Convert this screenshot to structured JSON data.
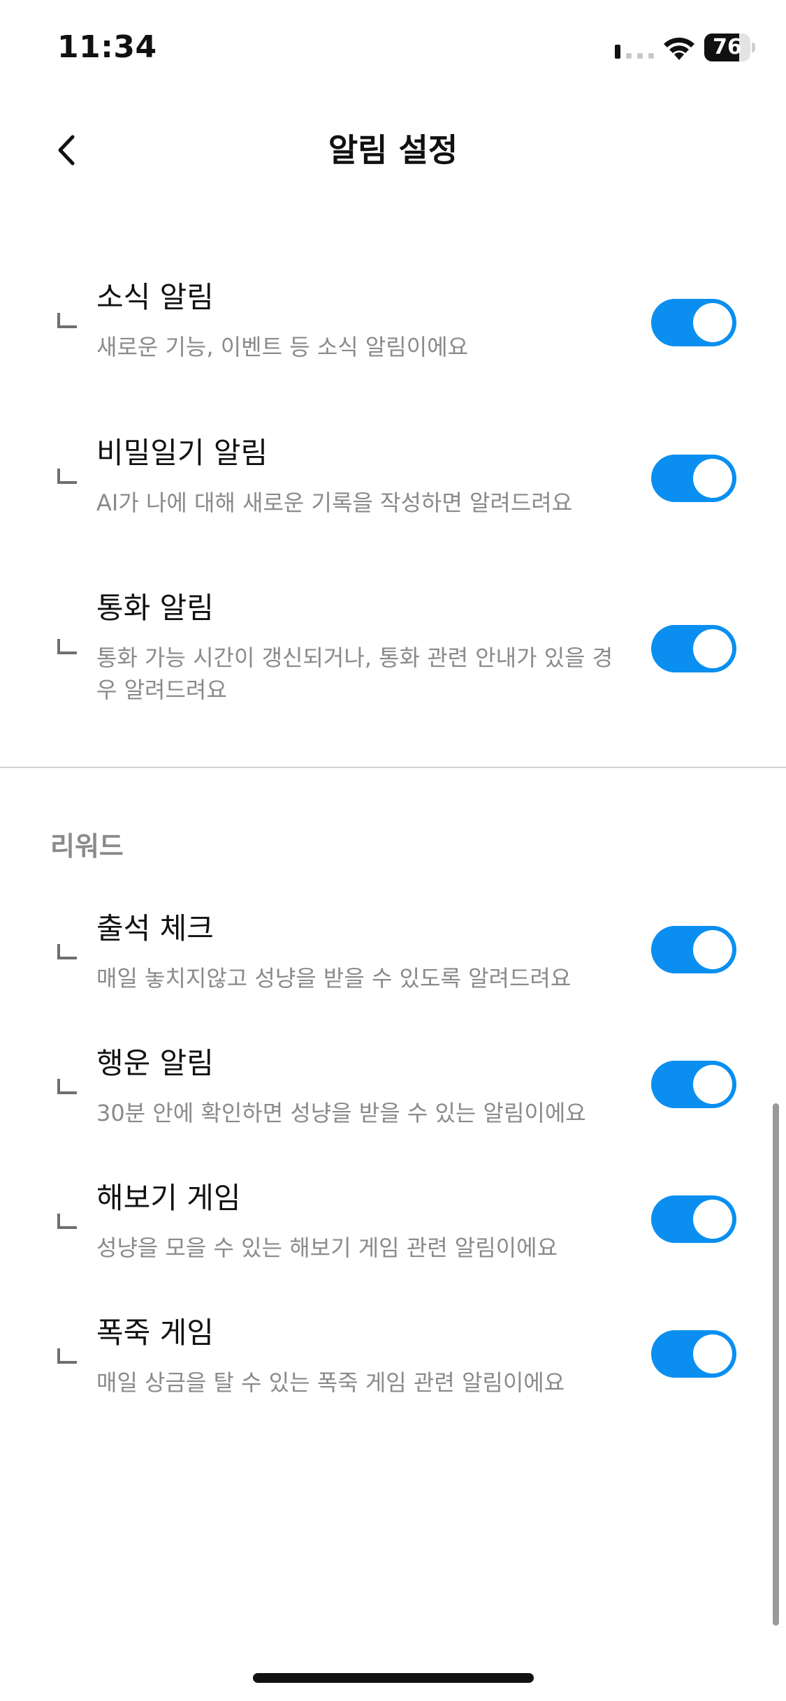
{
  "status_bar": {
    "time": "11:34",
    "battery_level": "76",
    "battery_fraction": 0.76,
    "signal_icon": "cellular-signal-icon",
    "wifi_icon": "wifi-icon"
  },
  "header": {
    "title": "알림 설정",
    "back_icon": "chevron-left-icon"
  },
  "notifications": [
    {
      "title": "소식 알림",
      "description": "새로운 기능, 이벤트 등 소식 알림이에요",
      "enabled": true
    },
    {
      "title": "비밀일기 알림",
      "description": "AI가 나에 대해 새로운 기록을 작성하면 알려드려요",
      "enabled": true
    },
    {
      "title": "통화 알림",
      "description": "통화 가능 시간이 갱신되거나, 통화 관련 안내가 있을 경우 알려드려요",
      "enabled": true
    }
  ],
  "rewards_section": {
    "header": "리워드",
    "items": [
      {
        "title": "출석 체크",
        "description": "매일 놓치지않고 성냥을 받을 수 있도록 알려드려요",
        "enabled": true
      },
      {
        "title": "행운 알림",
        "description": "30분 안에 확인하면 성냥을 받을 수 있는 알림이에요",
        "enabled": true
      },
      {
        "title": "해보기 게임",
        "description": "성냥을 모을 수 있는 해보기 게임 관련 알림이에요",
        "enabled": true
      },
      {
        "title": "폭죽 게임",
        "description": "매일 상금을 탈 수 있는 폭죽 게임 관련 알림이에요",
        "enabled": true
      }
    ]
  },
  "colors": {
    "toggle_on": "#0a8ff0",
    "description_text": "#8a8a8a",
    "title_text": "#111111"
  }
}
